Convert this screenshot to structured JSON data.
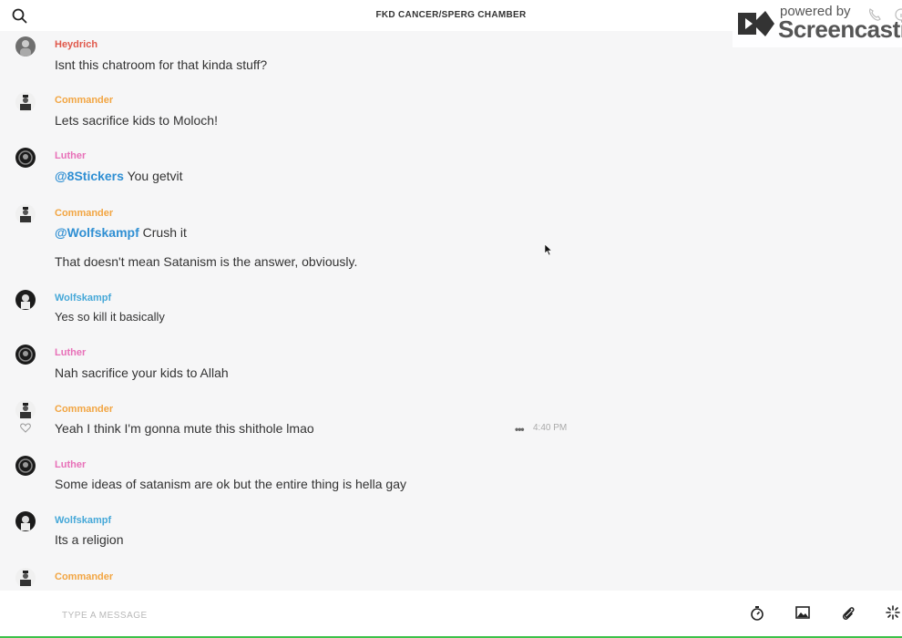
{
  "header": {
    "title": "FKD CANCER/SPERG CHAMBER"
  },
  "watermark": {
    "small": "powered by",
    "big": "Screencastify"
  },
  "messages": [
    {
      "author": "Heydrich",
      "color": "#e0584b",
      "text": "Isnt this chatroom for that kinda stuff?"
    },
    {
      "author": "Commander",
      "color": "#f2a542",
      "text": "Lets sacrifice kids to Moloch!"
    },
    {
      "author": "Luther",
      "color": "#e870b8",
      "mention": "@8Stickers",
      "text": "You getvit"
    },
    {
      "author": "Commander",
      "color": "#f2a542",
      "mention": "@Wolfskampf",
      "text": "Crush it",
      "text2": "That doesn't mean Satanism is the answer, obviously."
    },
    {
      "author": "Wolfskampf",
      "color": "#46a8d8",
      "text": "Yes so kill it basically"
    },
    {
      "author": "Luther",
      "color": "#e870b8",
      "text": "Nah sacrifice your kids to Allah"
    },
    {
      "author": "Commander",
      "color": "#f2a542",
      "text": "Yeah I think I'm gonna mute this shithole lmao",
      "more": "•••",
      "time": "4:40 PM"
    },
    {
      "author": "Luther",
      "color": "#e870b8",
      "text": "Some ideas of satanism are ok but the entire thing is hella gay"
    },
    {
      "author": "Wolfskampf",
      "color": "#46a8d8",
      "text": "Its a religion"
    },
    {
      "author": "Commander",
      "color": "#f2a542",
      "text": ""
    }
  ],
  "composer": {
    "placeholder": "TYPE A MESSAGE"
  },
  "icons": {
    "search": "search-icon",
    "phone": "phone-icon",
    "info": "info-icon",
    "timer": "timer-icon",
    "image": "image-icon",
    "attach": "paperclip-icon",
    "sparkle": "sparkle-icon",
    "like": "heart-icon",
    "cursor": "cursor-icon"
  }
}
